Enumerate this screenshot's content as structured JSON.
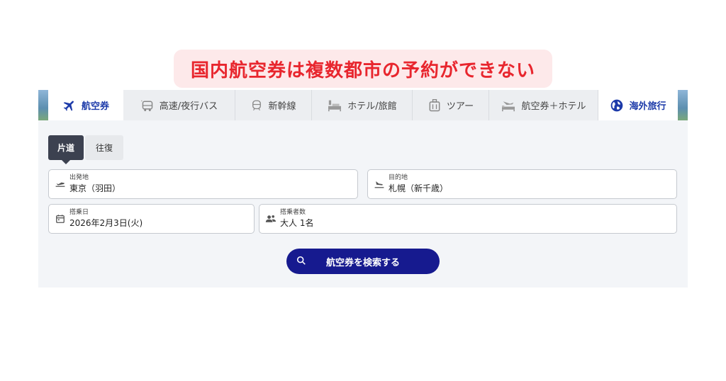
{
  "caption": "国内航空券は複数都市の予約ができない",
  "tabs": [
    {
      "label": "航空券",
      "icon": "airplane-icon",
      "active": true
    },
    {
      "label": "高速/夜行バス",
      "icon": "bus-icon"
    },
    {
      "label": "新幹線",
      "icon": "train-icon"
    },
    {
      "label": "ホテル/旅館",
      "icon": "hotel-icon"
    },
    {
      "label": "ツアー",
      "icon": "luggage-icon"
    },
    {
      "label": "航空券＋ホテル",
      "icon": "flight-hotel-icon"
    },
    {
      "label": "海外旅行",
      "icon": "globe-icon"
    }
  ],
  "trip_type": {
    "one_way": "片道",
    "round_trip": "往復",
    "selected": "片道"
  },
  "form": {
    "departure": {
      "label": "出発地",
      "value": "東京（羽田）"
    },
    "destination": {
      "label": "目的地",
      "value": "札幌（新千歳）"
    },
    "date": {
      "label": "搭乗日",
      "value": "2026年2月3日(火)"
    },
    "passengers": {
      "label": "搭乗者数",
      "value": "大人 1名"
    }
  },
  "search_button": "航空券を検索する",
  "colors": {
    "accent": "#1c3aa9",
    "button": "#161a8f",
    "caption_text": "#e8262e",
    "caption_bg": "#fde9ea"
  }
}
